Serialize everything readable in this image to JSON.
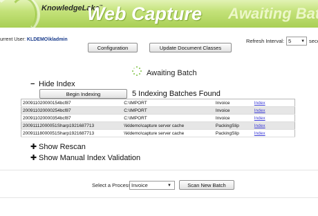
{
  "banner": {
    "brand": "KnowledgeLake",
    "brand_mark": "™",
    "product": "Web Capture",
    "status": "Awaiting Batch",
    "colors": {
      "banner_light": "#e2f3b5",
      "banner_dark": "#a9cf55",
      "spinner": "#7cc242",
      "link": "#3b3bd6"
    }
  },
  "header": {
    "user_label": "urrent User:",
    "user_value": "KLDEMO\\kladmin",
    "refresh_label": "Refresh Interval:",
    "refresh_value": "5",
    "refresh_unit": "second"
  },
  "toolbar": {
    "configuration_label": "Configuration",
    "update_label": "Update Document Classes"
  },
  "status": {
    "awaiting_text": "Awaiting Batch",
    "spinner_icon": "loading-spinner-icon"
  },
  "index_section": {
    "toggle_symbol": "−",
    "toggle_label": "Hide Index",
    "begin_label": "Begin Indexing",
    "found_text": "5 Indexing Batches Found",
    "rows": [
      {
        "batch": "200911020000154bcf87",
        "path": "C:\\IMPORT",
        "doc_class": "Invoice",
        "action": "Index"
      },
      {
        "batch": "200911020000254bcf87",
        "path": "C:\\IMPORT",
        "doc_class": "Invoice",
        "action": "Index"
      },
      {
        "batch": "200911020000354bcf87",
        "path": "C:\\IMPORT",
        "doc_class": "Invoice",
        "action": "Index"
      },
      {
        "batch": "20091112000051Sharp1921687713",
        "path": "\\\\kldemo\\capture server cache",
        "doc_class": "PackingSlip",
        "action": "Index"
      },
      {
        "batch": "20091118000051Sharp1921687713",
        "path": "\\\\kldemo\\capture server cache",
        "doc_class": "PackingSlip",
        "action": "Index"
      }
    ]
  },
  "rescan_section": {
    "toggle_symbol": "✚",
    "toggle_label": "Show Rescan"
  },
  "validation_section": {
    "toggle_symbol": "✚",
    "toggle_label": "Show Manual Index Validation"
  },
  "process": {
    "label": "Select a Process",
    "selected": "Invoice",
    "scan_label": "Scan New Batch"
  }
}
